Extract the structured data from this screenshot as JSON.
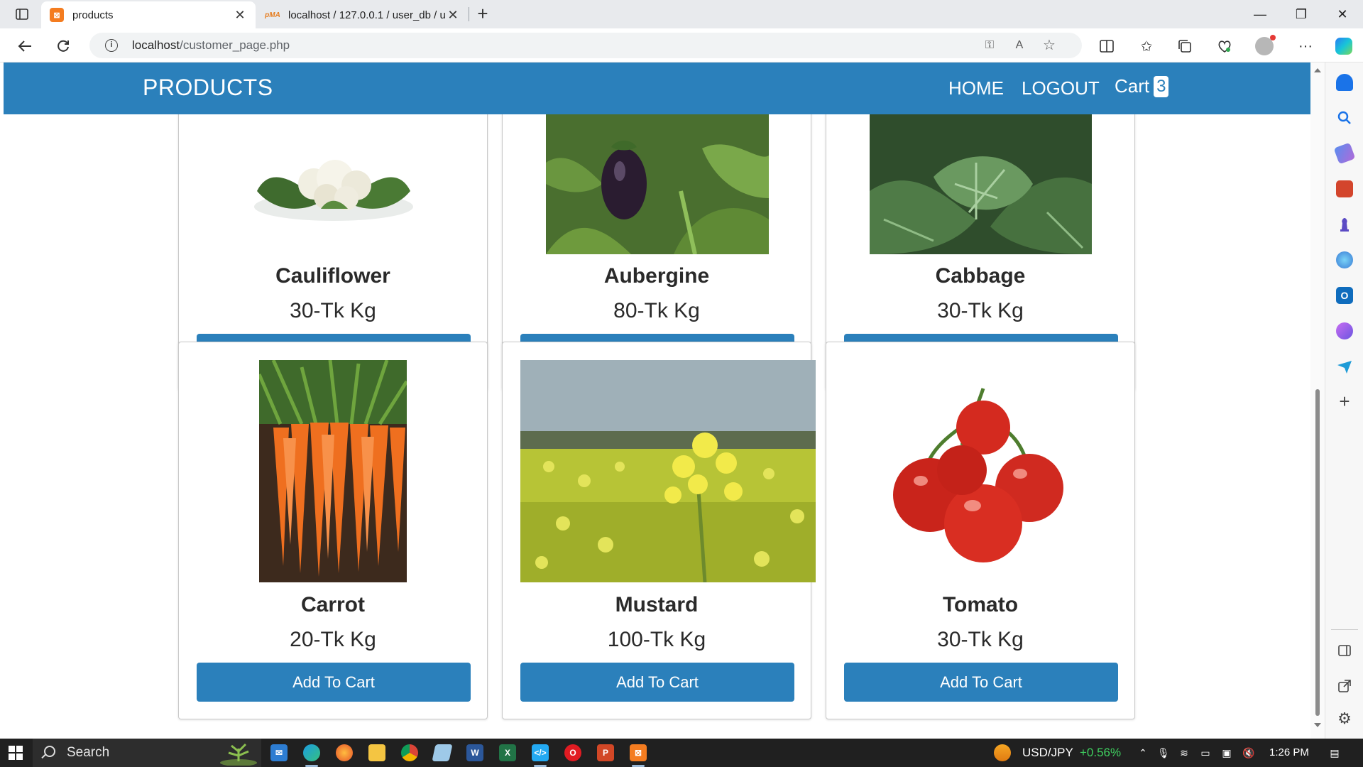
{
  "browser": {
    "tabs": [
      {
        "title": "products",
        "favicon": "xampp-icon",
        "active": true
      },
      {
        "title": "localhost / 127.0.0.1 / user_db / u",
        "favicon": "phpmyadmin-icon",
        "active": false
      }
    ],
    "address": {
      "host": "localhost",
      "path": "/customer_page.php",
      "info_glyph": "i"
    }
  },
  "navbar": {
    "brand": "PRODUCTS",
    "links": {
      "home": "HOME",
      "logout": "LOGOUT",
      "cart": "Cart"
    },
    "cart_count": "3"
  },
  "products": [
    {
      "name": "Cauliflower",
      "price": "30-Tk Kg",
      "button": "Add To Cart"
    },
    {
      "name": "Aubergine",
      "price": "80-Tk Kg",
      "button": "Add To Cart"
    },
    {
      "name": "Cabbage",
      "price": "30-Tk Kg",
      "button": "Add To Cart"
    },
    {
      "name": "Carrot",
      "price": "20-Tk Kg",
      "button": "Add To Cart"
    },
    {
      "name": "Mustard",
      "price": "100-Tk Kg",
      "button": "Add To Cart"
    },
    {
      "name": "Tomato",
      "price": "30-Tk Kg",
      "button": "Add To Cart"
    }
  ],
  "taskbar": {
    "search_label": "Search",
    "ticker": {
      "symbol": "USD/JPY",
      "change": "+0.56%"
    },
    "time": "1:26 PM"
  },
  "colors": {
    "brand_blue": "#2b80bb",
    "ticker_green": "#3fcf5f"
  }
}
